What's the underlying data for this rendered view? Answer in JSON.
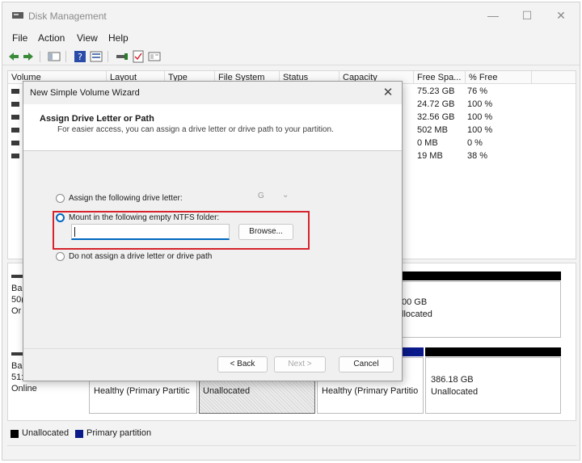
{
  "window": {
    "title": "Disk Management",
    "controls": {
      "minimize": "—",
      "maximize": "☐",
      "close": "✕"
    }
  },
  "menu": [
    "File",
    "Action",
    "View",
    "Help"
  ],
  "volume_list": {
    "columns": [
      "Volume",
      "Layout",
      "Type",
      "File System",
      "Status",
      "Capacity",
      "Free Spa...",
      "% Free"
    ],
    "rows": [
      {
        "free": "75.23 GB",
        "pct": "76 %"
      },
      {
        "free": "24.72 GB",
        "pct": "100 %"
      },
      {
        "free": "32.56 GB",
        "pct": "100 %"
      },
      {
        "free": "502 MB",
        "pct": "100 %"
      },
      {
        "free": "0 MB",
        "pct": "0 %"
      },
      {
        "free": "19 MB",
        "pct": "38 %"
      }
    ]
  },
  "disk_pane": {
    "disk0": {
      "label_line1": "Ba",
      "label_line2": "50(",
      "label_line3": "Or",
      "right_size": "00 GB",
      "right_status": "llocated"
    },
    "disk1": {
      "label_line1": "Ba",
      "label_line2": "51:",
      "label_line3": "Online",
      "part1_status": "Healthy (Primary Partitic",
      "part2_status": "Unallocated",
      "part3_status": "Healthy (Primary Partitio",
      "part4_size": "386.18 GB",
      "part4_status": "Unallocated"
    }
  },
  "legend": {
    "unallocated": "Unallocated",
    "primary": "Primary partition"
  },
  "dialog": {
    "title": "New Simple Volume Wizard",
    "heading": "Assign Drive Letter or Path",
    "subheading": "For easier access, you can assign a drive letter or drive path to your partition.",
    "options": {
      "assign_letter": "Assign the following drive letter:",
      "mount_folder": "Mount in the following empty NTFS folder:",
      "no_assign": "Do not assign a drive letter or drive path"
    },
    "drive_letter": "G",
    "folder_path": "",
    "browse": "Browse...",
    "back": "< Back",
    "next": "Next >",
    "cancel": "Cancel"
  },
  "colors": {
    "accent": "#0067c0",
    "highlight_border": "#d6232c",
    "unallocated_stripe": "#000000",
    "primary_stripe": "#0a1a8a"
  }
}
